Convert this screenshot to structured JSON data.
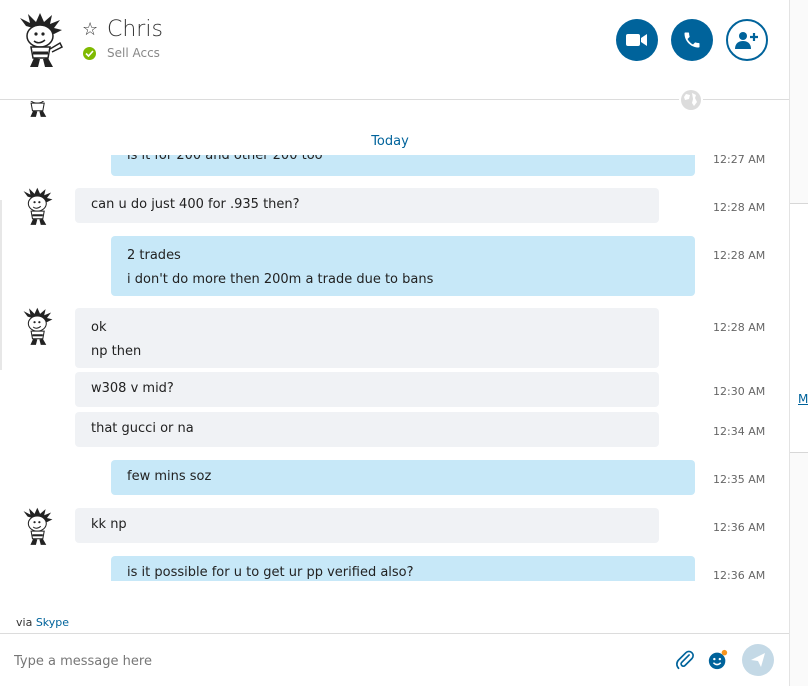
{
  "header": {
    "contact_name": "Chris",
    "status_text": "Sell Accs",
    "status_color": "#7fba00",
    "icons": [
      "star-icon",
      "video-call-icon",
      "audio-call-icon",
      "add-contact-icon",
      "globe-icon"
    ]
  },
  "conversation": {
    "date_separator": "Today",
    "messages": [
      {
        "direction": "out",
        "lines": [
          "is it for 200 and other 200 too"
        ],
        "time": "12:27 AM"
      },
      {
        "direction": "in",
        "lines": [
          "can u do just 400 for .935 then?"
        ],
        "time": "12:28 AM"
      },
      {
        "direction": "out",
        "lines": [
          "2 trades",
          "i don't do more then 200m a trade due to bans"
        ],
        "time": "12:28 AM"
      },
      {
        "direction": "in",
        "lines": [
          "ok",
          "np then"
        ],
        "time": "12:28 AM"
      },
      {
        "direction": "in",
        "lines": [
          "w308 v mid?"
        ],
        "time": "12:30 AM"
      },
      {
        "direction": "in",
        "lines": [
          "that gucci or na"
        ],
        "time": "12:34 AM"
      },
      {
        "direction": "out",
        "lines": [
          "few mins soz"
        ],
        "time": "12:35 AM"
      },
      {
        "direction": "in",
        "lines": [
          "kk np"
        ],
        "time": "12:36 AM"
      },
      {
        "direction": "out",
        "lines": [
          "is it possible for u to get ur pp verified also?"
        ],
        "time": "12:36 AM"
      }
    ]
  },
  "footer": {
    "via_prefix": "via",
    "via_link": "Skype",
    "composer_placeholder": "Type a message here"
  },
  "side_panel": {
    "link_text": "M"
  },
  "colors": {
    "accent": "#00639b",
    "incoming_bubble": "#f0f2f5",
    "outgoing_bubble": "#c7e8f8",
    "online": "#7fba00"
  }
}
